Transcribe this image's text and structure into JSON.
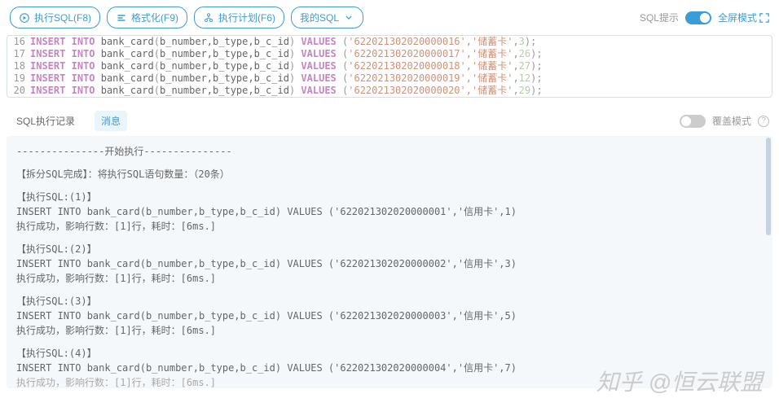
{
  "toolbar": {
    "execute": "执行SQL(F8)",
    "format": "格式化(F9)",
    "plan": "执行计划(F6)",
    "mysql": "我的SQL",
    "sql_hint": "SQL提示",
    "fullscreen": "全屏模式"
  },
  "editor": {
    "lines": [
      {
        "n": 16,
        "args": "b_number,b_type,b_c_id",
        "v1": "'622021302020000016'",
        "v2": "'储蓄卡'",
        "v3": "3"
      },
      {
        "n": 17,
        "args": "b_number,b_type,b_c_id",
        "v1": "'622021302020000017'",
        "v2": "'储蓄卡'",
        "v3": "26"
      },
      {
        "n": 18,
        "args": "b_number,b_type,b_c_id",
        "v1": "'622021302020000018'",
        "v2": "'储蓄卡'",
        "v3": "27"
      },
      {
        "n": 19,
        "args": "b_number,b_type,b_c_id",
        "v1": "'622021302020000019'",
        "v2": "'储蓄卡'",
        "v3": "12"
      },
      {
        "n": 20,
        "args": "b_number,b_type,b_c_id",
        "v1": "'622021302020000020'",
        "v2": "'储蓄卡'",
        "v3": "29"
      }
    ]
  },
  "tabs": {
    "history": "SQL执行记录",
    "message": "消息",
    "overwrite": "覆盖模式"
  },
  "output": {
    "start": "---------------开始执行---------------",
    "split": "【拆分SQL完成】：将执行SQL语句数量：（20条）",
    "runs": [
      {
        "header": "【执行SQL:(1)】",
        "sql": "INSERT INTO bank_card(b_number,b_type,b_c_id) VALUES ('622021302020000001','信用卡',1)",
        "result": "执行成功，影响行数：[1]行，耗时：[6ms.]"
      },
      {
        "header": "【执行SQL:(2)】",
        "sql": "INSERT INTO bank_card(b_number,b_type,b_c_id) VALUES ('622021302020000002','信用卡',3)",
        "result": "执行成功，影响行数：[1]行，耗时：[6ms.]"
      },
      {
        "header": "【执行SQL:(3)】",
        "sql": "INSERT INTO bank_card(b_number,b_type,b_c_id) VALUES ('622021302020000003','信用卡',5)",
        "result": "执行成功，影响行数：[1]行，耗时：[6ms.]"
      },
      {
        "header": "【执行SQL:(4)】",
        "sql": "INSERT INTO bank_card(b_number,b_type,b_c_id) VALUES ('622021302020000004','信用卡',7)",
        "result": "执行成功，影响行数：[1]行，耗时：[6ms.]"
      }
    ]
  },
  "watermark": "知乎 @恒云联盟"
}
